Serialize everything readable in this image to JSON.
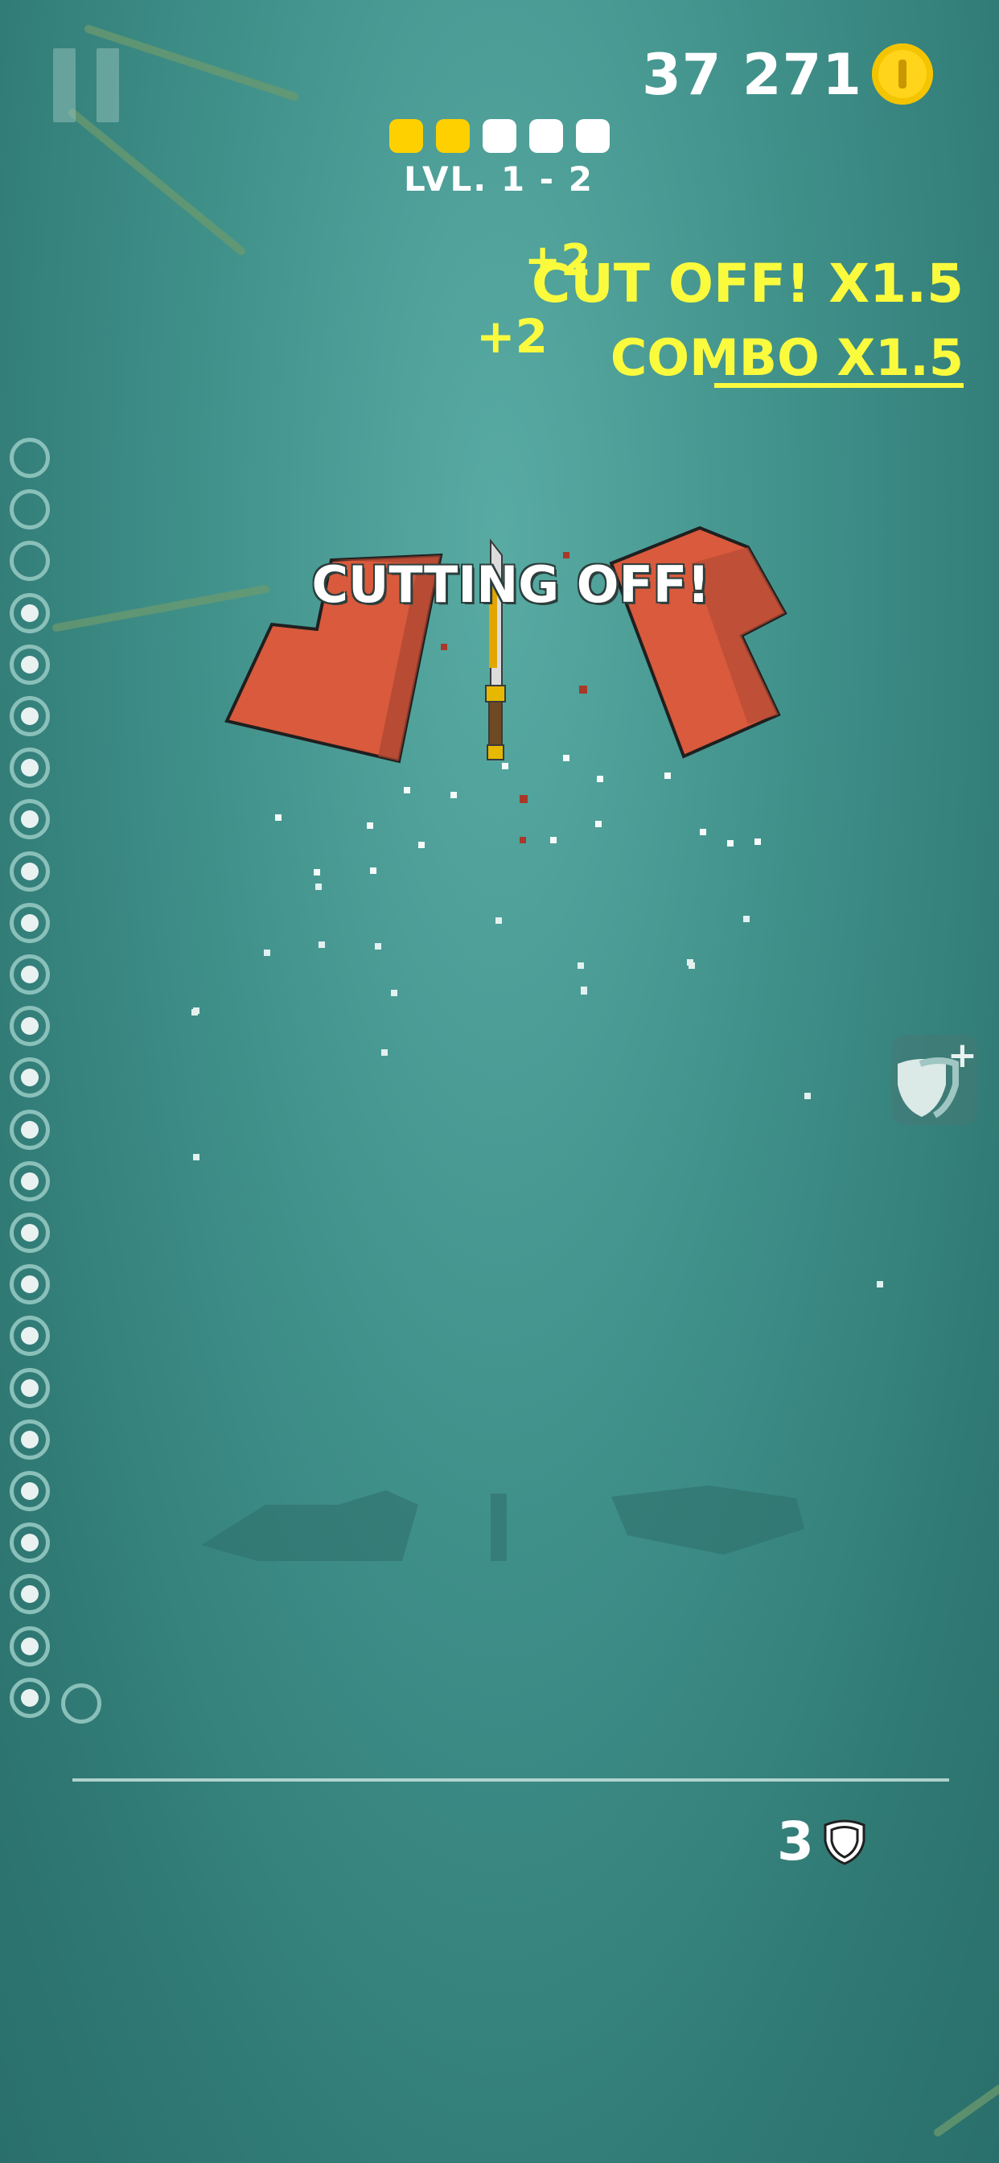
{
  "hud": {
    "coins": "37 271",
    "level": "LVL. 1 - 2",
    "level_progress": {
      "filled": 2,
      "total": 5
    },
    "lives": "3"
  },
  "feedback": {
    "float_1": "+2",
    "float_2": "+2",
    "cut_off": "CUT OFF! X1.5",
    "combo": "COMBO X1.5",
    "banner": "CUTTING OFF!"
  },
  "rail": {
    "total": 25,
    "filled": 22
  },
  "icons": {
    "pause": "pause-icon",
    "coin": "coin-icon",
    "shield": "shield-icon",
    "plus": "plus-icon"
  },
  "colors": {
    "accent_yellow": "#fbfb3e",
    "coin_gold": "#ffd41a",
    "fruit_red": "#d95a3c",
    "background": "#3f8f89"
  }
}
